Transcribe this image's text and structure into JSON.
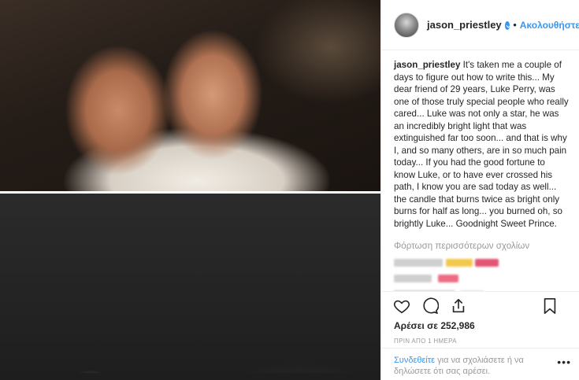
{
  "post": {
    "username": "jason_priestley",
    "follow_label": "Ακολουθήστε",
    "caption_user": "jason_priestley",
    "caption_text": " It's taken me a couple of days to figure out how to write this... My dear friend of 29 years, Luke Perry, was one of those truly special people who really cared... Luke was not only a star, he was an incredibly bright light that was extinguished far too soon... and that is why I, and so many others, are in so much pain today... If you had the good fortune to know Luke, or to have ever crossed his path, I know you are sad today as well... the candle that burns twice as bright only burns for half as long... you burned oh, so brightly Luke... Goodnight Sweet Prince.",
    "load_more_comments": "Φόρτωση περισσότερων σχολίων",
    "likes_label": "Αρέσει σε 252,986",
    "time_ago": "ΠΡΙΝ ΑΠΟ 1 ΗΜΕΡΑ",
    "login_link": "Συνδεθείτε",
    "login_text": " για να σχολιάσετε ή να δηλώσετε ότι σας αρέσει.",
    "more_options": "•••"
  },
  "icons": {
    "header": [
      "avatar",
      "verified-badge-icon"
    ],
    "actions": [
      "heart-icon",
      "comment-icon",
      "share-icon",
      "bookmark-icon"
    ]
  },
  "colors": {
    "accent": "#3897f0",
    "text": "#262626",
    "muted": "#999999",
    "border": "#efefef"
  }
}
